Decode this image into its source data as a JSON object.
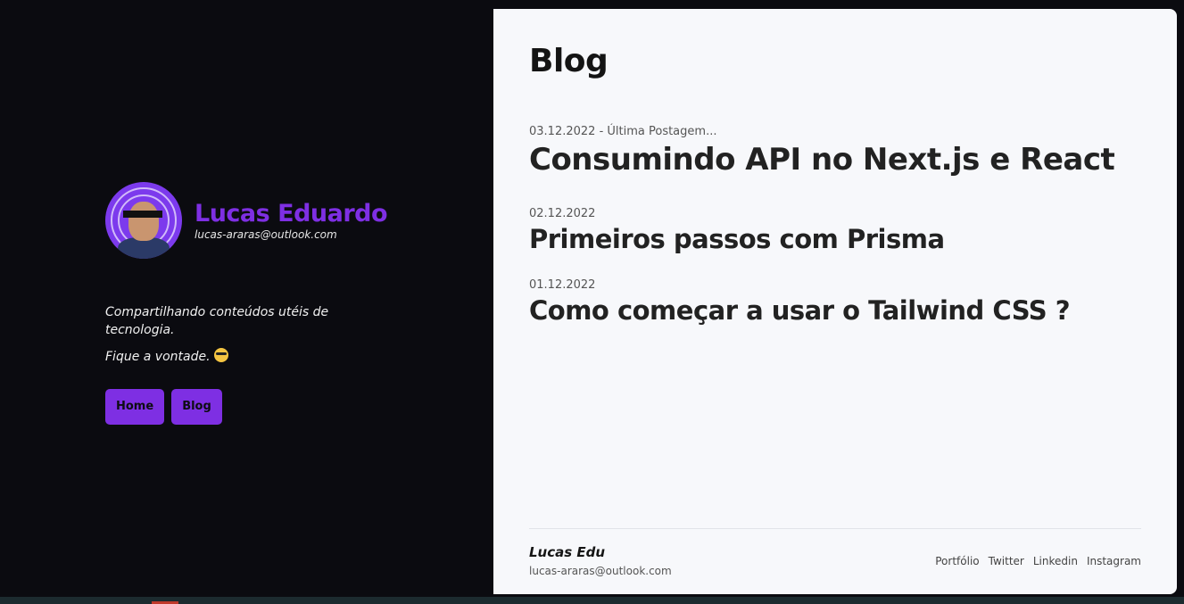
{
  "profile": {
    "name": "Lucas Eduardo",
    "email": "lucas-araras@outlook.com",
    "tagline": "Compartilhando conteúdos utéis de tecnologia.",
    "tagline2": "Fique a vontade."
  },
  "nav": {
    "home_label": "Home",
    "blog_label": "Blog"
  },
  "main": {
    "title": "Blog",
    "posts": [
      {
        "date": "03.12.2022 - Última Postagem...",
        "title": "Consumindo API no Next.js e React"
      },
      {
        "date": "02.12.2022",
        "title": "Primeiros passos com Prisma"
      },
      {
        "date": "01.12.2022",
        "title": "Como começar a usar o Tailwind CSS ?"
      }
    ]
  },
  "footer": {
    "name": "Lucas Edu",
    "email": "lucas-araras@outlook.com",
    "links": [
      "Portfólio",
      "Twitter",
      "Linkedin",
      "Instagram"
    ]
  },
  "colors": {
    "accent": "#7e2fe3",
    "sidebar_bg": "#0b0b10",
    "content_bg": "#f7f8fb"
  },
  "icons": {
    "avatar": "profile-photo",
    "emoji": "sunglasses-emoji-icon"
  }
}
